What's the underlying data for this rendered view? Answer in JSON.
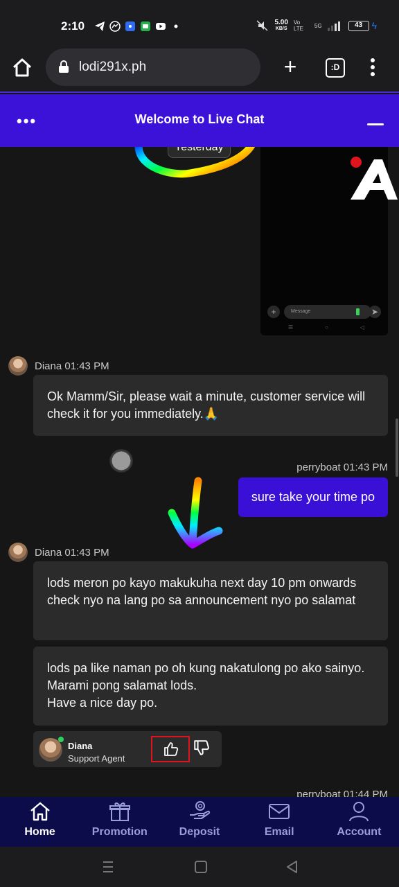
{
  "status_bar": {
    "time": "2:10",
    "speed_value": "5.00",
    "speed_unit": "KB/S",
    "network_labels": "Vo LTE",
    "signal_label": "5G",
    "battery": "43"
  },
  "browser": {
    "url": "lodi291x.ph",
    "tab_label": ":D"
  },
  "chat_header": {
    "title": "Welcome to Live Chat"
  },
  "chat": {
    "date_divider": "Yesterday",
    "screenshot_placeholder": "Message",
    "messages": [
      {
        "sender": "Diana",
        "time": "01:43 PM",
        "meta": "Diana 01:43 PM",
        "text": "Ok Mamm/Sir, please wait a minute, customer service will check it for you immediately.🙏"
      },
      {
        "sender": "perryboat",
        "time": "01:43 PM",
        "meta": "perryboat 01:43 PM",
        "text": "sure take your time po"
      },
      {
        "sender": "Diana",
        "time": "01:43 PM",
        "meta": "Diana 01:43 PM",
        "text": "lods meron po kayo makukuha next day 10 pm onwards check nyo na lang po sa announcement nyo po salamat"
      },
      {
        "sender": "Diana",
        "time": "01:43 PM",
        "text_lines": [
          "lods pa like naman po oh kung nakatulong po ako sainyo. Marami pong salamat lods.",
          "Have a nice day po."
        ]
      }
    ],
    "rating_card": {
      "agent_name": "Diana",
      "agent_role": "Support Agent"
    },
    "partial_meta": "perryboat 01:44 PM"
  },
  "bottom_nav": {
    "items": [
      {
        "label": "Home",
        "active": true
      },
      {
        "label": "Promotion",
        "active": false
      },
      {
        "label": "Deposit",
        "active": false
      },
      {
        "label": "Email",
        "active": false
      },
      {
        "label": "Account",
        "active": false
      }
    ]
  },
  "colors": {
    "accent": "#3d12d8",
    "nav_bg": "#0c0c4a",
    "bubble_in": "#2b2b2b",
    "bubble_out": "#3a0fd6",
    "highlight_box": "#e0141c"
  }
}
